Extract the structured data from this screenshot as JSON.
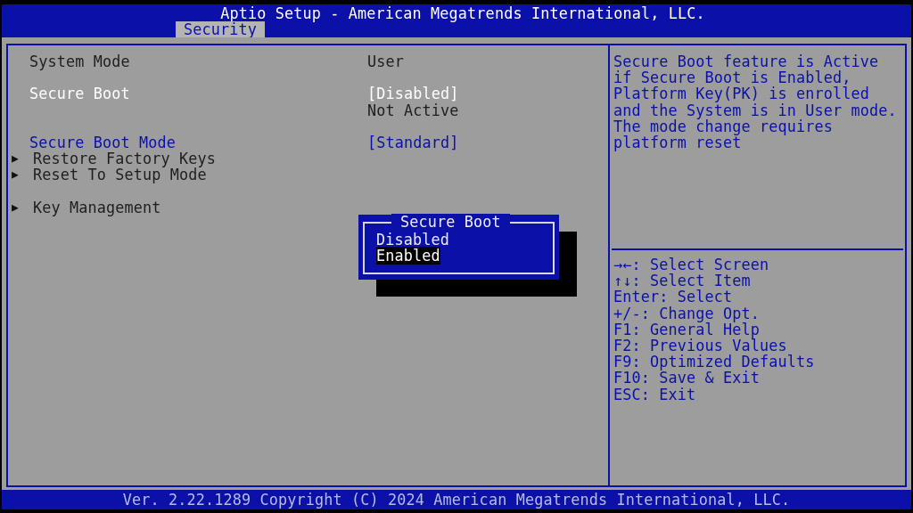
{
  "window": {
    "title": "Aptio Setup - American Megatrends International, LLC."
  },
  "tabs": [
    {
      "label": "Security",
      "selected": true
    }
  ],
  "settings": [
    {
      "kind": "info",
      "label": "System Mode",
      "value": "User"
    },
    {
      "kind": "gap"
    },
    {
      "kind": "option",
      "label": "Secure Boot",
      "value": "[Disabled]",
      "selected": true
    },
    {
      "kind": "info",
      "value": "Not Active"
    },
    {
      "kind": "gap"
    },
    {
      "kind": "option",
      "label": "Secure Boot Mode",
      "value": "[Standard]",
      "selected": false
    },
    {
      "kind": "submenu",
      "arrow": "▶",
      "label": "Restore Factory Keys"
    },
    {
      "kind": "submenu",
      "arrow": "▶",
      "label": "Reset To Setup Mode"
    },
    {
      "kind": "gap"
    },
    {
      "kind": "submenu",
      "arrow": "▶",
      "label": "Key Management"
    }
  ],
  "popup": {
    "title": "Secure Boot",
    "options": [
      {
        "label": "Disabled",
        "selected": false
      },
      {
        "label": "Enabled",
        "selected": true
      }
    ]
  },
  "help_text": [
    "Secure Boot feature is Active",
    "if Secure Boot is Enabled,",
    "Platform Key(PK) is enrolled",
    "and the System is in User mode.",
    "The mode change requires",
    "platform reset"
  ],
  "key_hints": [
    "→←: Select Screen",
    "↑↓: Select Item",
    "Enter: Select",
    "+/-: Change Opt.",
    "F1: General Help",
    "F2: Previous Values",
    "F9: Optimized Defaults",
    "F10: Save & Exit",
    "ESC: Exit"
  ],
  "status_bar": "Ver. 2.22.1289 Copyright (C) 2024 American Megatrends International, LLC."
}
